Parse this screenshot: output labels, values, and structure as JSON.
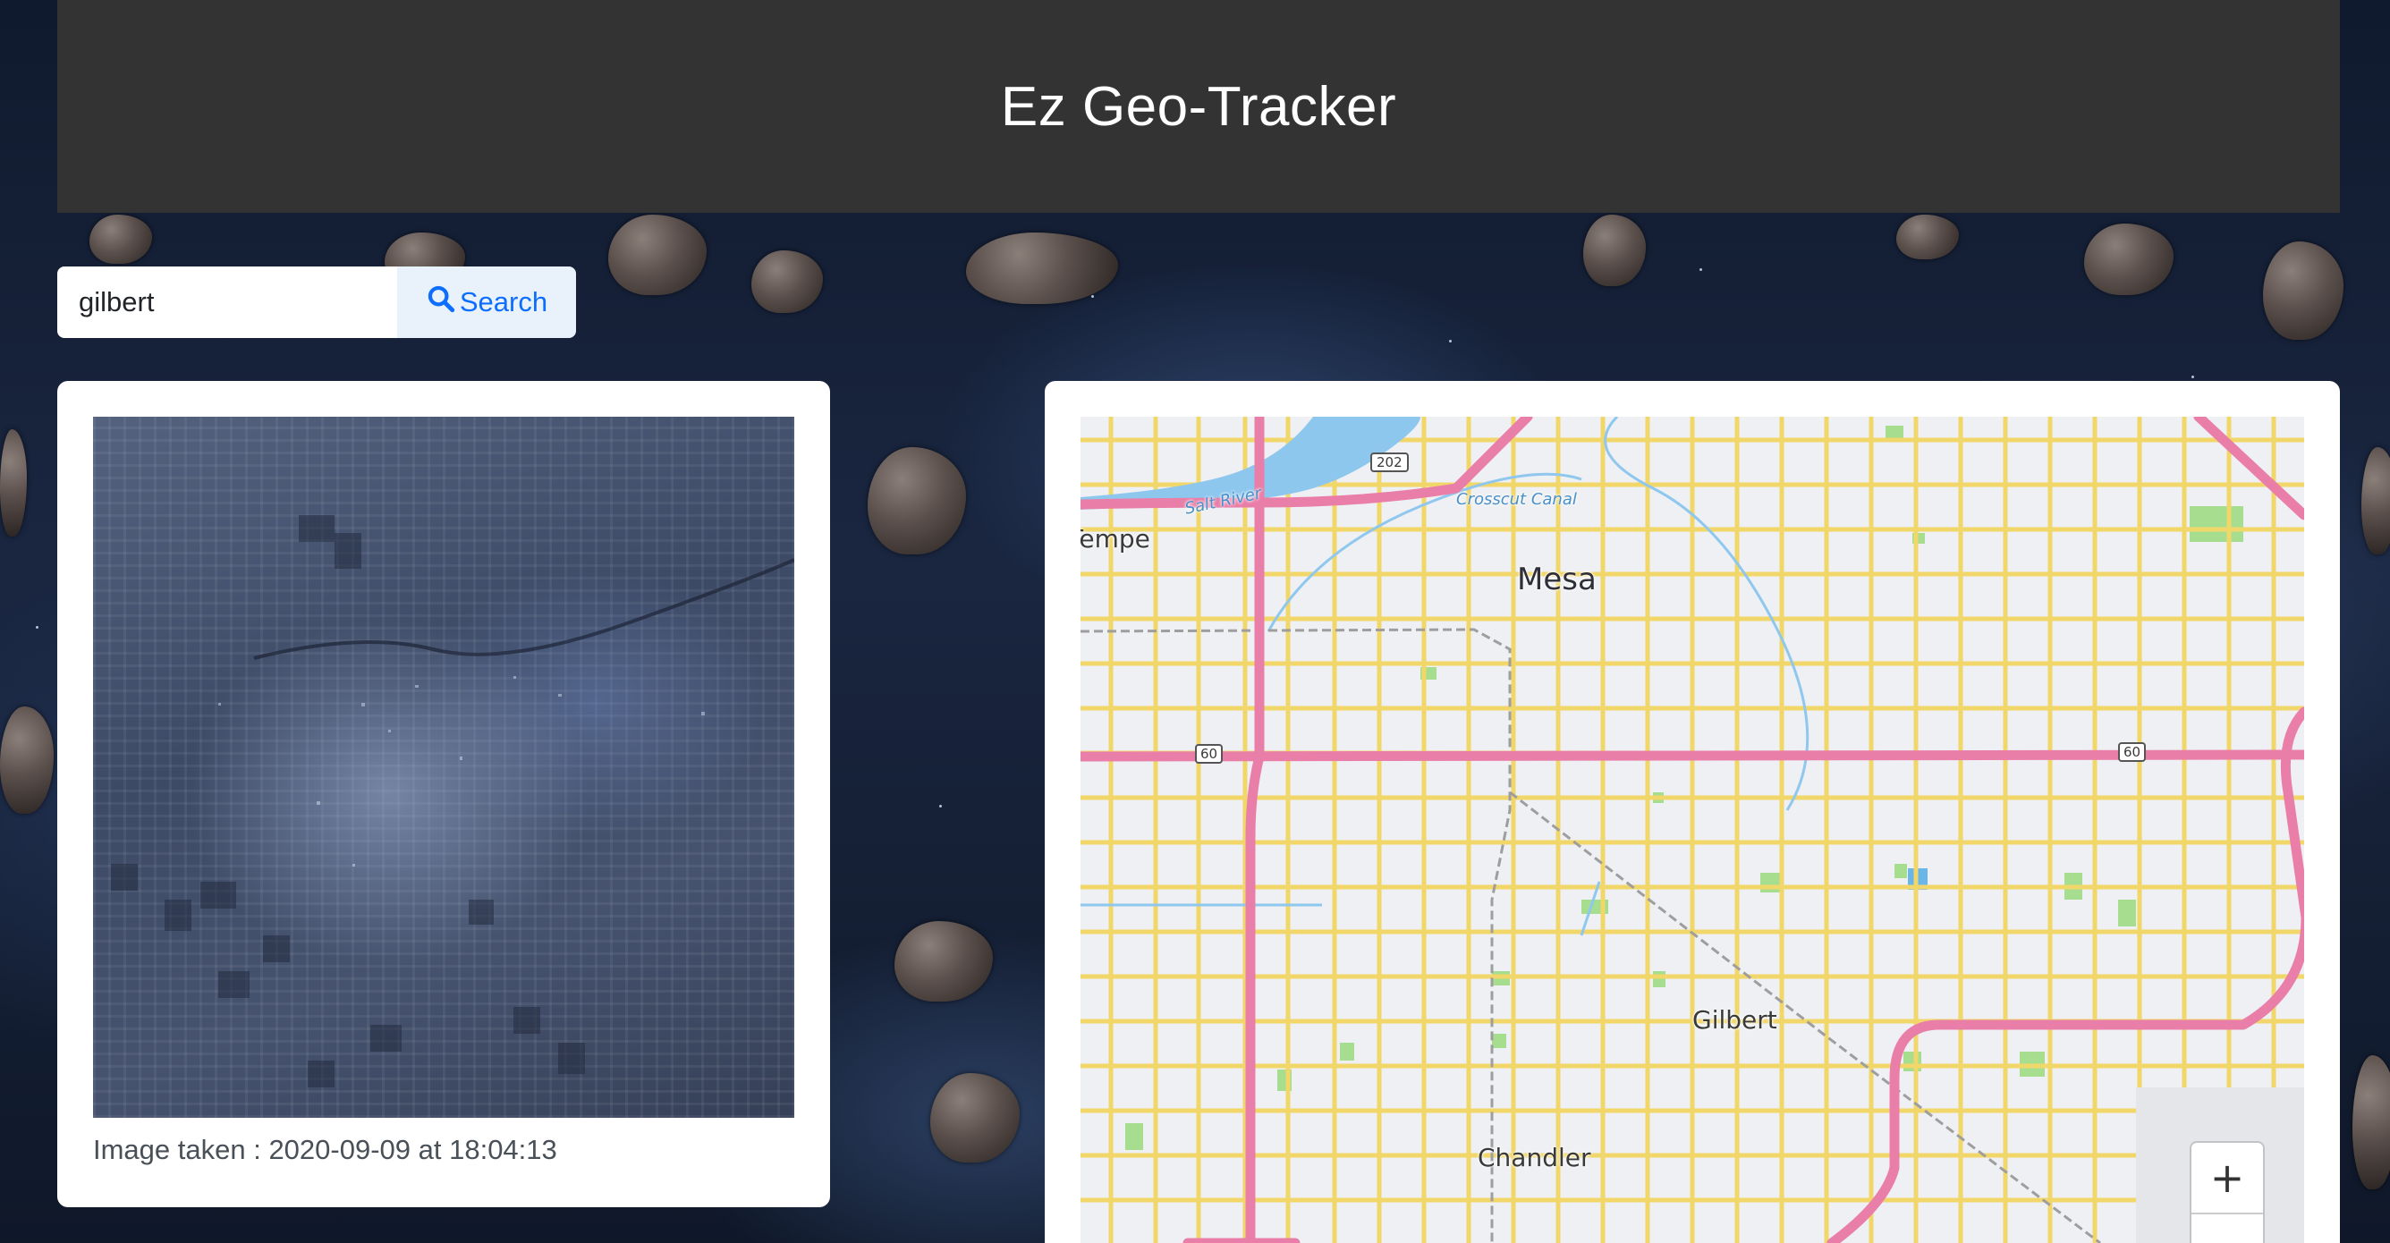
{
  "app": {
    "title": "Ez Geo-Tracker"
  },
  "search": {
    "value": "gilbert",
    "button_label": "Search"
  },
  "satellite": {
    "caption": "Image taken : 2020-09-09 at 18:04:13"
  },
  "map": {
    "labels": {
      "tempe": "Tempe",
      "mesa": "Mesa",
      "gilbert": "Gilbert",
      "chandler": "Chandler",
      "salt_river": "Salt River",
      "crosscut_canal": "Crosscut Canal"
    },
    "shields": {
      "route_202": "202",
      "route_60_west": "60",
      "route_60_east": "60"
    },
    "zoom_in_label": "+"
  }
}
